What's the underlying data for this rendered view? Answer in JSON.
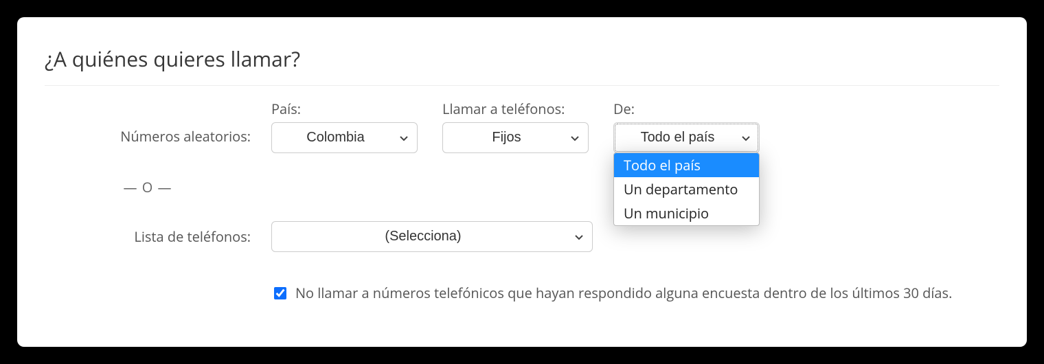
{
  "title": "¿A quiénes quieres llamar?",
  "labels": {
    "random_numbers": "Números aleatorios:",
    "country": "País:",
    "call_phones": "Llamar a teléfonos:",
    "from": "De:",
    "or": "— O —",
    "phone_list": "Lista de teléfonos:"
  },
  "selects": {
    "country": "Colombia",
    "phone_type": "Fijos",
    "from": "Todo el país",
    "phone_list": "(Selecciona)"
  },
  "from_options": [
    {
      "label": "Todo el país",
      "selected": true
    },
    {
      "label": "Un departamento",
      "selected": false
    },
    {
      "label": "Un municipio",
      "selected": false
    }
  ],
  "checkbox": {
    "checked": true,
    "label": "No llamar a números telefónicos que hayan respondido alguna encuesta dentro de los últimos 30 días."
  }
}
